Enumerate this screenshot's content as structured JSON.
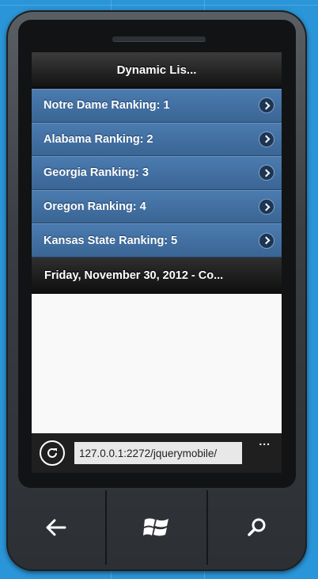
{
  "app": {
    "header_title": "Dynamic Lis..."
  },
  "list": {
    "items": [
      {
        "label": "Notre Dame Ranking: 1"
      },
      {
        "label": "Alabama Ranking: 2"
      },
      {
        "label": "Georgia Ranking: 3"
      },
      {
        "label": "Oregon Ranking: 4"
      },
      {
        "label": "Kansas State Ranking: 5"
      }
    ],
    "item_icon": "chevron-right-circle-icon"
  },
  "footer": {
    "text": "Friday, November 30, 2012 - Co..."
  },
  "browser": {
    "url": "127.0.0.1:2272/jquerymobile/",
    "refresh_icon": "refresh-icon",
    "more_label": "..."
  },
  "hardware": {
    "back_icon": "back-arrow-icon",
    "start_icon": "windows-logo-icon",
    "search_icon": "search-icon"
  },
  "colors": {
    "desktop_bg": "#2a95d8",
    "list_item_bg": "#3a6594",
    "header_bg": "#111111"
  }
}
